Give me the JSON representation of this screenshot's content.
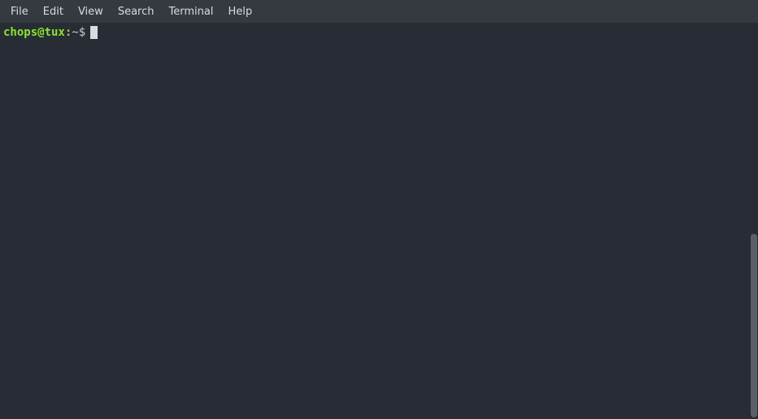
{
  "menubar": {
    "items": [
      {
        "label": "File"
      },
      {
        "label": "Edit"
      },
      {
        "label": "View"
      },
      {
        "label": "Search"
      },
      {
        "label": "Terminal"
      },
      {
        "label": "Help"
      }
    ]
  },
  "terminal": {
    "prompt": {
      "userhost": "chops@tux:",
      "path": "~",
      "symbol": "$"
    }
  }
}
